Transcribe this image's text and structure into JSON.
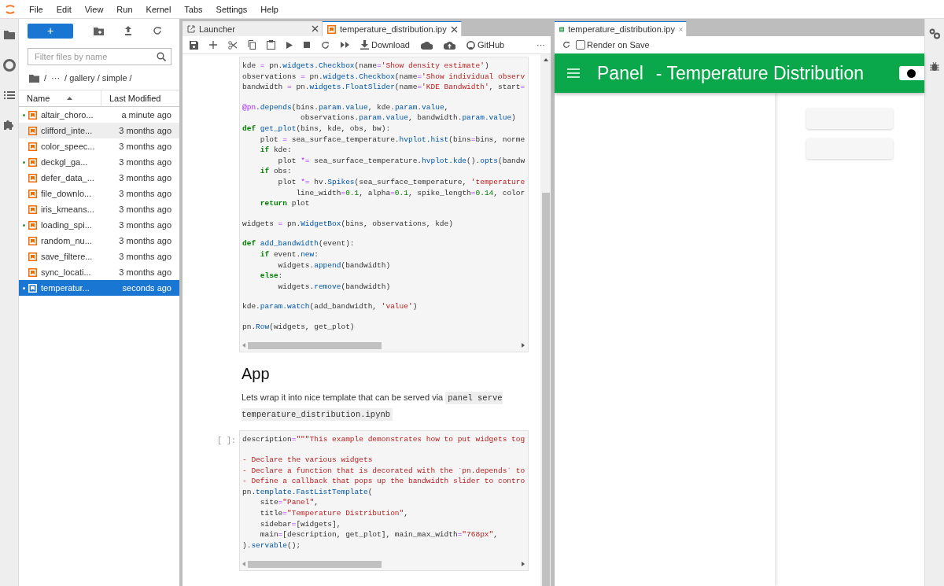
{
  "menu": [
    "File",
    "Edit",
    "View",
    "Run",
    "Kernel",
    "Tabs",
    "Settings",
    "Help"
  ],
  "file_browser": {
    "new_button": "+",
    "filter": {
      "placeholder": "Filter files by name"
    },
    "breadcrumb": [
      "/",
      "···",
      "/ gallery / simple /"
    ],
    "columns": [
      {
        "label": "Name",
        "sorted": true
      },
      {
        "label": "Last Modified",
        "sorted": false
      }
    ],
    "files": [
      {
        "name": "altair_choro...",
        "modified": "a minute ago",
        "running": true,
        "selected": false,
        "hovered": false
      },
      {
        "name": "clifford_inte...",
        "modified": "3 months ago",
        "running": false,
        "selected": false,
        "hovered": true
      },
      {
        "name": "color_speec...",
        "modified": "3 months ago",
        "running": false,
        "selected": false,
        "hovered": false
      },
      {
        "name": "deckgl_ga...",
        "modified": "3 months ago",
        "running": true,
        "selected": false,
        "hovered": false
      },
      {
        "name": "defer_data_...",
        "modified": "3 months ago",
        "running": false,
        "selected": false,
        "hovered": false
      },
      {
        "name": "file_downlo...",
        "modified": "3 months ago",
        "running": false,
        "selected": false,
        "hovered": false
      },
      {
        "name": "iris_kmeans...",
        "modified": "3 months ago",
        "running": false,
        "selected": false,
        "hovered": false
      },
      {
        "name": "loading_spi...",
        "modified": "3 months ago",
        "running": true,
        "selected": false,
        "hovered": false
      },
      {
        "name": "random_nu...",
        "modified": "3 months ago",
        "running": false,
        "selected": false,
        "hovered": false
      },
      {
        "name": "save_filtere...",
        "modified": "3 months ago",
        "running": false,
        "selected": false,
        "hovered": false
      },
      {
        "name": "sync_locati...",
        "modified": "3 months ago",
        "running": false,
        "selected": false,
        "hovered": false
      },
      {
        "name": "temperatur...",
        "modified": "seconds ago",
        "running": true,
        "selected": true,
        "hovered": false
      }
    ]
  },
  "notebook": {
    "tabs": [
      {
        "label": "Launcher",
        "kind": "launcher",
        "selected": false
      },
      {
        "label": "temperature_distribution.ipy",
        "kind": "notebook",
        "selected": true
      }
    ],
    "toolbar": {
      "download": "Download",
      "github": "GitHub",
      "more": "···"
    },
    "cells": [
      {
        "kind": "code",
        "blocks": [
          [
            [
              {
                "kind": "plain",
                "text": "kde "
              },
              {
                "kind": "operator",
                "text": "="
              },
              {
                "kind": "plain",
                "text": " pn."
              },
              {
                "kind": "name",
                "text": "widgets.Checkbox"
              },
              {
                "kind": "plain",
                "text": "(name"
              },
              {
                "kind": "operator",
                "text": "="
              },
              {
                "kind": "string",
                "text": "'Show density estimate'"
              },
              {
                "kind": "plain",
                "text": ")"
              }
            ],
            [
              {
                "kind": "plain",
                "text": "observations "
              },
              {
                "kind": "operator",
                "text": "="
              },
              {
                "kind": "plain",
                "text": " pn."
              },
              {
                "kind": "name",
                "text": "widgets.Checkbox"
              },
              {
                "kind": "plain",
                "text": "(name"
              },
              {
                "kind": "operator",
                "text": "="
              },
              {
                "kind": "string",
                "text": "'Show individual observ"
              }
            ],
            [
              {
                "kind": "plain",
                "text": "bandwidth "
              },
              {
                "kind": "operator",
                "text": "="
              },
              {
                "kind": "plain",
                "text": " pn."
              },
              {
                "kind": "name",
                "text": "widgets.FloatSlider"
              },
              {
                "kind": "plain",
                "text": "(name"
              },
              {
                "kind": "operator",
                "text": "="
              },
              {
                "kind": "string",
                "text": "'KDE Bandwidth'"
              },
              {
                "kind": "plain",
                "text": ", start"
              },
              {
                "kind": "operator",
                "text": "="
              }
            ]
          ],
          [
            [
              {
                "kind": "decorator",
                "text": "@pn"
              },
              {
                "kind": "plain",
                "text": "."
              },
              {
                "kind": "name",
                "text": "depends"
              },
              {
                "kind": "plain",
                "text": "(bins."
              },
              {
                "kind": "name",
                "text": "param.value"
              },
              {
                "kind": "plain",
                "text": ", kde."
              },
              {
                "kind": "name",
                "text": "param.value"
              },
              {
                "kind": "plain",
                "text": ","
              }
            ],
            [
              {
                "kind": "plain",
                "text": "             observations."
              },
              {
                "kind": "name",
                "text": "param.value"
              },
              {
                "kind": "plain",
                "text": ", bandwidth."
              },
              {
                "kind": "name",
                "text": "param.value"
              },
              {
                "kind": "plain",
                "text": ")"
              }
            ],
            [
              {
                "kind": "keyword",
                "text": "def"
              },
              {
                "kind": "name",
                "text": " get_plot"
              },
              {
                "kind": "plain",
                "text": "(bins, kde, obs, bw):"
              }
            ],
            [
              {
                "kind": "plain",
                "text": "    plot "
              },
              {
                "kind": "operator",
                "text": "="
              },
              {
                "kind": "plain",
                "text": " sea_surface_temperature."
              },
              {
                "kind": "name",
                "text": "hvplot.hist"
              },
              {
                "kind": "plain",
                "text": "(bins"
              },
              {
                "kind": "operator",
                "text": "="
              },
              {
                "kind": "plain",
                "text": "bins, norme"
              }
            ],
            [
              {
                "kind": "keyword",
                "text": "    if"
              },
              {
                "kind": "plain",
                "text": " kde:"
              }
            ],
            [
              {
                "kind": "plain",
                "text": "        plot "
              },
              {
                "kind": "operator",
                "text": "*="
              },
              {
                "kind": "plain",
                "text": " sea_surface_temperature."
              },
              {
                "kind": "name",
                "text": "hvplot.kde"
              },
              {
                "kind": "plain",
                "text": "()."
              },
              {
                "kind": "name",
                "text": "opts"
              },
              {
                "kind": "plain",
                "text": "(bandw"
              }
            ],
            [
              {
                "kind": "keyword",
                "text": "    if"
              },
              {
                "kind": "plain",
                "text": " obs:"
              }
            ],
            [
              {
                "kind": "plain",
                "text": "        plot "
              },
              {
                "kind": "operator",
                "text": "*="
              },
              {
                "kind": "plain",
                "text": " hv."
              },
              {
                "kind": "name",
                "text": "Spikes"
              },
              {
                "kind": "plain",
                "text": "(sea_surface_temperature, "
              },
              {
                "kind": "string",
                "text": "'temperature"
              }
            ],
            [
              {
                "kind": "plain",
                "text": "            line_width"
              },
              {
                "kind": "operator",
                "text": "="
              },
              {
                "kind": "number",
                "text": "0.1"
              },
              {
                "kind": "plain",
                "text": ", alpha"
              },
              {
                "kind": "operator",
                "text": "="
              },
              {
                "kind": "number",
                "text": "0.1"
              },
              {
                "kind": "plain",
                "text": ", spike_length"
              },
              {
                "kind": "operator",
                "text": "="
              },
              {
                "kind": "number",
                "text": "0.14"
              },
              {
                "kind": "plain",
                "text": ", color"
              }
            ],
            [
              {
                "kind": "keyword",
                "text": "    return"
              },
              {
                "kind": "plain",
                "text": " plot"
              }
            ]
          ],
          [
            [
              {
                "kind": "plain",
                "text": "widgets "
              },
              {
                "kind": "operator",
                "text": "="
              },
              {
                "kind": "plain",
                "text": " pn."
              },
              {
                "kind": "name",
                "text": "WidgetBox"
              },
              {
                "kind": "plain",
                "text": "(bins, observations, kde)"
              }
            ]
          ],
          [
            [
              {
                "kind": "keyword",
                "text": "def"
              },
              {
                "kind": "name",
                "text": " add_bandwidth"
              },
              {
                "kind": "plain",
                "text": "(event):"
              }
            ],
            [
              {
                "kind": "keyword",
                "text": "    if"
              },
              {
                "kind": "plain",
                "text": " event."
              },
              {
                "kind": "name",
                "text": "new"
              },
              {
                "kind": "plain",
                "text": ":"
              }
            ],
            [
              {
                "kind": "plain",
                "text": "        widgets."
              },
              {
                "kind": "name",
                "text": "append"
              },
              {
                "kind": "plain",
                "text": "(bandwidth)"
              }
            ],
            [
              {
                "kind": "keyword",
                "text": "    else"
              },
              {
                "kind": "plain",
                "text": ":"
              }
            ],
            [
              {
                "kind": "plain",
                "text": "        widgets."
              },
              {
                "kind": "name",
                "text": "remove"
              },
              {
                "kind": "plain",
                "text": "(bandwidth)"
              }
            ]
          ],
          [
            [
              {
                "kind": "plain",
                "text": "kde."
              },
              {
                "kind": "name",
                "text": "param.watch"
              },
              {
                "kind": "plain",
                "text": "(add_bandwidth, "
              },
              {
                "kind": "string",
                "text": "'value'"
              },
              {
                "kind": "plain",
                "text": ")"
              }
            ]
          ],
          [
            [
              {
                "kind": "plain",
                "text": "pn."
              },
              {
                "kind": "name",
                "text": "Row"
              },
              {
                "kind": "plain",
                "text": "(widgets, get_plot)"
              }
            ]
          ]
        ]
      },
      {
        "kind": "markdown",
        "heading": "App",
        "text": "Lets wrap it into nice template that can be served via",
        "code": "panel serve temperature_distribution.ipynb"
      },
      {
        "kind": "code",
        "prompt": "[ ]:",
        "blocks": [
          [
            [
              {
                "kind": "plain",
                "text": "description"
              },
              {
                "kind": "operator",
                "text": "="
              },
              {
                "kind": "string",
                "text": "\"\"\"This example demonstrates how to put widgets tog"
              }
            ]
          ],
          [
            [
              {
                "kind": "string",
                "text": "- Declare the various widgets"
              }
            ],
            [
              {
                "kind": "string",
                "text": "- Declare a function that is decorated with the `pn.depends` to"
              }
            ],
            [
              {
                "kind": "string",
                "text": "- Define a callback that pops up the bandwidth slider to contro"
              }
            ],
            [
              {
                "kind": "plain",
                "text": "pn."
              },
              {
                "kind": "name",
                "text": "template.FastListTemplate"
              },
              {
                "kind": "plain",
                "text": "("
              }
            ],
            [
              {
                "kind": "plain",
                "text": "    site"
              },
              {
                "kind": "operator",
                "text": "="
              },
              {
                "kind": "string",
                "text": "\"Panel\""
              },
              {
                "kind": "plain",
                "text": ","
              }
            ],
            [
              {
                "kind": "plain",
                "text": "    title"
              },
              {
                "kind": "operator",
                "text": "="
              },
              {
                "kind": "string",
                "text": "\"Temperature Distribution\""
              },
              {
                "kind": "plain",
                "text": ","
              }
            ],
            [
              {
                "kind": "plain",
                "text": "    sidebar"
              },
              {
                "kind": "operator",
                "text": "="
              },
              {
                "kind": "plain",
                "text": "[widgets],"
              }
            ],
            [
              {
                "kind": "plain",
                "text": "    main"
              },
              {
                "kind": "operator",
                "text": "="
              },
              {
                "kind": "plain",
                "text": "[description, get_plot], main_max_width"
              },
              {
                "kind": "operator",
                "text": "="
              },
              {
                "kind": "string",
                "text": "\"768px\""
              },
              {
                "kind": "plain",
                "text": ","
              }
            ],
            [
              {
                "kind": "plain",
                "text": ")."
              },
              {
                "kind": "name",
                "text": "servable"
              },
              {
                "kind": "plain",
                "text": "();"
              }
            ]
          ]
        ]
      }
    ]
  },
  "preview": {
    "tab": {
      "label": "temperature_distribution.ipy",
      "selected": true
    },
    "render_on_save": {
      "label": "Render on Save",
      "checked": false
    },
    "header": {
      "site": "Panel",
      "title": "- Temperature Distribution",
      "dark_theme": false
    }
  }
}
